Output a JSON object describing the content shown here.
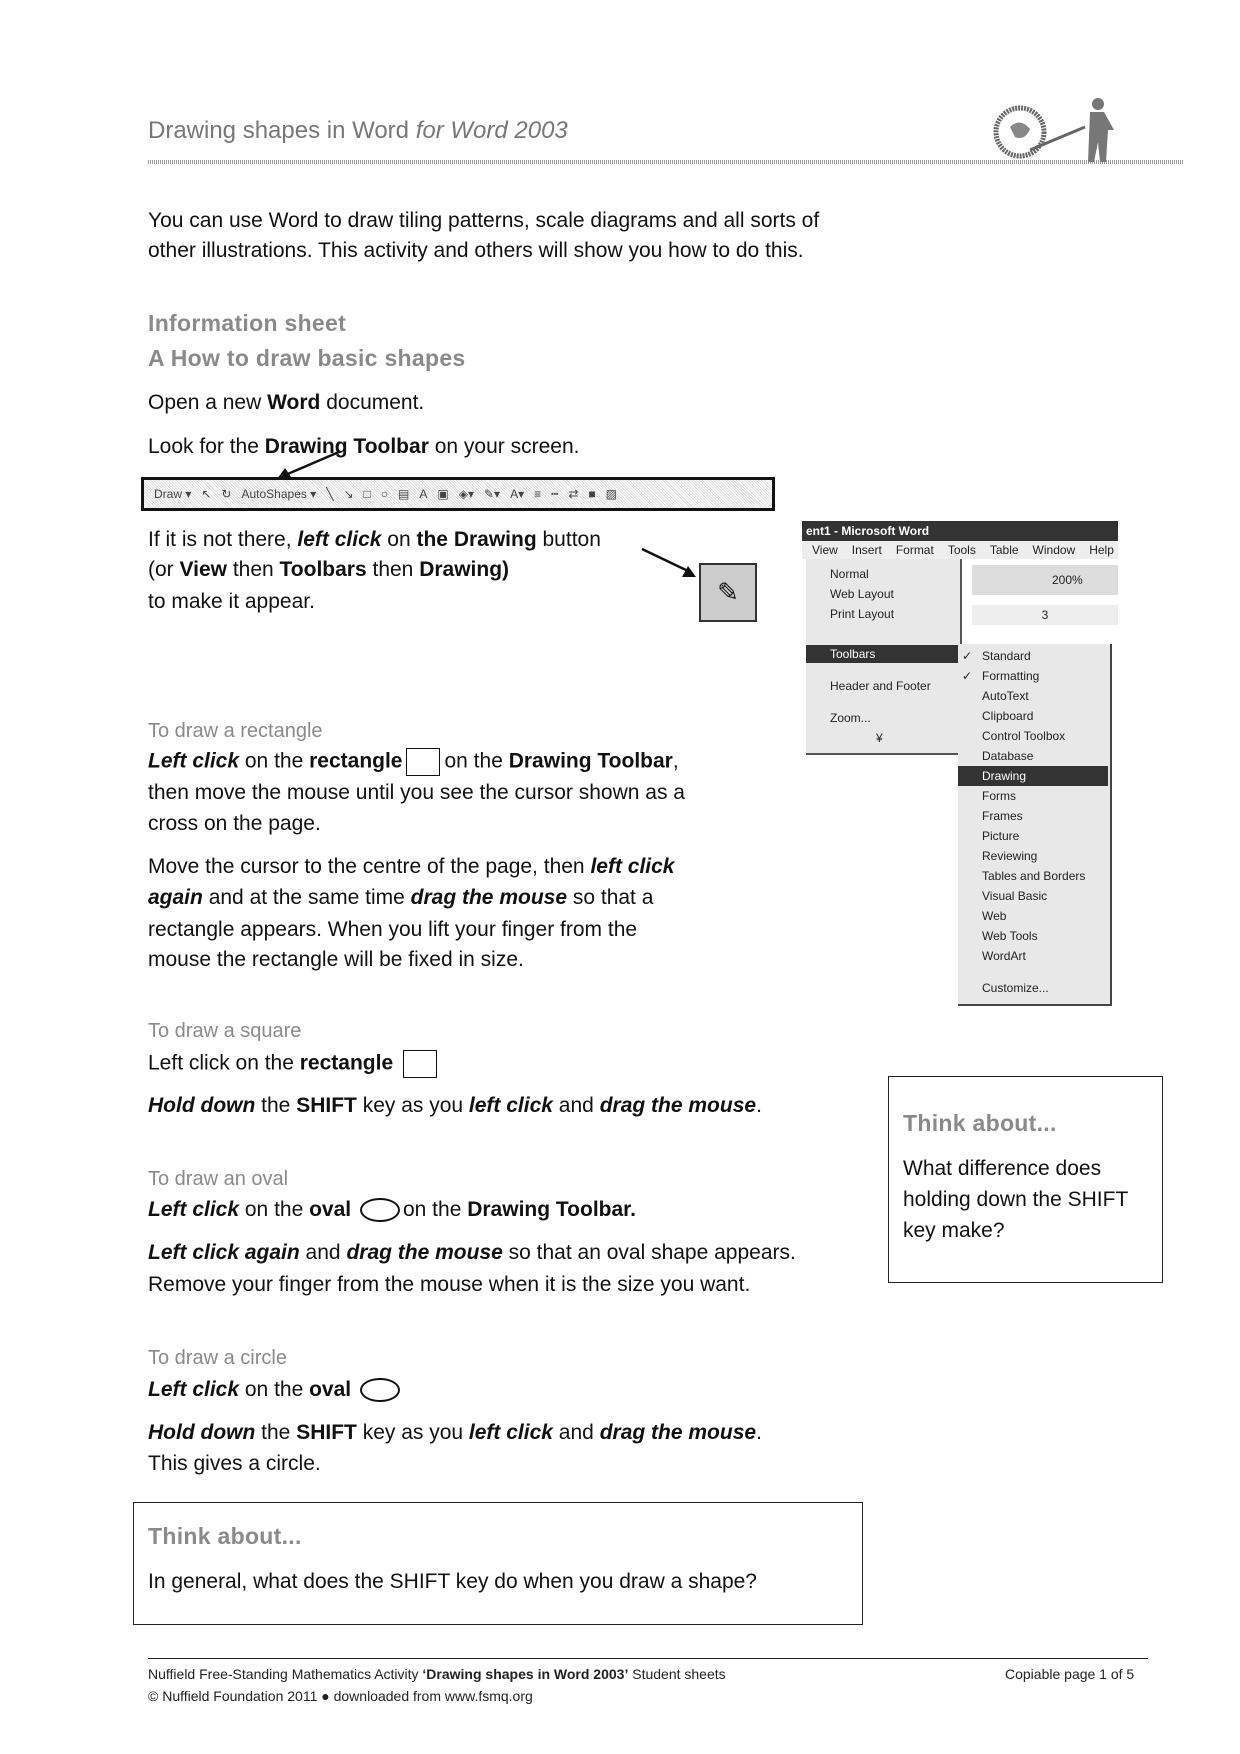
{
  "header": {
    "title": "Drawing shapes in Word",
    "title_italic": "for Word 2003",
    "logo": "globe-and-figure-logo"
  },
  "intro": [
    "You can use Word to draw tiling patterns, scale diagrams and all sorts of",
    "other illustrations.  This activity and others will show you how to do this."
  ],
  "section": {
    "label": "Information sheet",
    "heading": "A How to draw basic shapes"
  },
  "steps": {
    "open_pre": "Open a new ",
    "open_bold": "Word",
    "open_post": " document.",
    "look_pre": "Look for the ",
    "look_bold": "Drawing Toolbar",
    "look_post": " on your screen."
  },
  "toolbar": {
    "draw": "Draw ▾",
    "autoshapes": "AutoShapes ▾"
  },
  "notthere": {
    "l1a": "If it is not there, ",
    "l1b": "left click",
    "l1c": " on ",
    "l1d": "the Drawing",
    "l1e": " button",
    "l2a": "(or ",
    "l2b": "View",
    "l2c": " then ",
    "l2d": "Toolbars",
    "l2e": " then ",
    "l2f": "Drawing)",
    "l3": "to make it appear."
  },
  "menu": {
    "title": "ent1 - Microsoft Word",
    "bar": [
      "View",
      "Insert",
      "Format",
      "Tools",
      "Table",
      "Window",
      "Help"
    ],
    "zoom": "200%",
    "ruler": "3",
    "view_items": [
      "Normal",
      "Web Layout",
      "Print Layout",
      "Toolbars",
      "Header and Footer",
      "Zoom...",
      "¥"
    ],
    "toolbar_items": [
      "Standard",
      "Formatting",
      "AutoText",
      "Clipboard",
      "Control Toolbox",
      "Database",
      "Drawing",
      "Forms",
      "Frames",
      "Picture",
      "Reviewing",
      "Tables and Borders",
      "Visual Basic",
      "Web",
      "Web Tools",
      "WordArt",
      "Customize..."
    ],
    "checked": [
      "Standard",
      "Formatting"
    ],
    "selected": "Drawing"
  },
  "rectangle": {
    "heading": "To draw a rectangle",
    "l1a": "Left click",
    "l1b": " on the ",
    "l1c": "rectangle",
    "l1d": "on the ",
    "l1e": "Drawing Toolbar",
    "l1f": ",",
    "l2": "then move the mouse until you see the cursor shown as a",
    "l3": "cross on the page.",
    "m1a": "Move the cursor to the centre of the page, then ",
    "m1b": "left click",
    "m2a": "again",
    "m2b": " and at the same time ",
    "m2c": "drag the mouse",
    "m2d": " so that a",
    "m3": "rectangle appears.  When you lift your finger from the",
    "m4": "mouse the rectangle will be fixed in size."
  },
  "square": {
    "heading": "To draw a square",
    "l1a": "Left click on the ",
    "l1b": "rectangle",
    "h1": "Hold down",
    "h2": " the ",
    "h3": "SHIFT",
    "h4": " key as you ",
    "h5": "left click",
    "h6": " and ",
    "h7": "drag the mouse",
    "h8": "."
  },
  "oval": {
    "heading": "To draw an oval",
    "l1a": "Left click",
    "l1b": " on the ",
    "l1c": "oval",
    "l1d": "on the ",
    "l1e": "Drawing Toolbar.",
    "m1a": "Left click again",
    "m1b": " and ",
    "m1c": "drag the mouse",
    "m1d": " so that an oval shape appears.",
    "m2": "Remove your finger from the mouse when it is the size you want."
  },
  "circle": {
    "heading": "To draw a circle",
    "l1a": "Left click",
    "l1b": " on the ",
    "l1c": "oval",
    "h1": "Hold down",
    "h2": " the ",
    "h3": "SHIFT",
    "h4": " key as you ",
    "h5": "left click",
    "h6": " and ",
    "h7": "drag the mouse",
    "h8": ".",
    "l3": "This gives a circle."
  },
  "think1": {
    "title": "Think about...",
    "lines": [
      "What difference does",
      "holding down the SHIFT",
      "key make?"
    ]
  },
  "think2": {
    "title": "Think about...",
    "text": "In general, what does the SHIFT key do when you draw a shape?"
  },
  "footer": {
    "l1a": "Nuffield Free-Standing Mathematics Activity ",
    "l1b": "‘Drawing shapes in Word 2003’",
    "l1c": " Student sheets",
    "l2": "© Nuffield Foundation 2011 ● downloaded from www.fsmq.org",
    "page": "Copiable page 1 of 5"
  }
}
